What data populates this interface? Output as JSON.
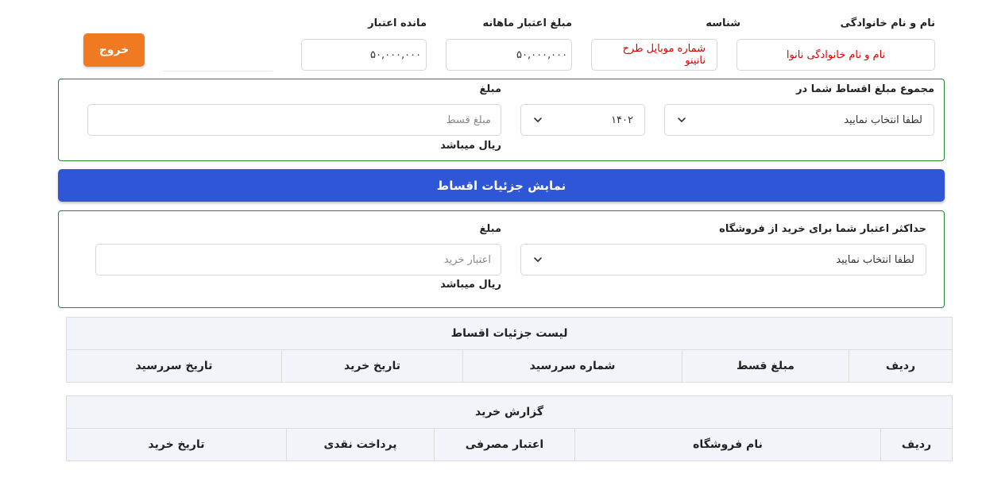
{
  "header": {
    "fields": [
      {
        "label": "نام و نام خانوادگی",
        "value": "نام و نام خانوادگی نانوا"
      },
      {
        "label": "شناسه",
        "value": "شماره موبایل طرح نانینو"
      },
      {
        "label": "مبلغ اعتبار ماهانه",
        "value": "۵۰,۰۰۰,۰۰۰"
      },
      {
        "label": "مانده اعتبار",
        "value": "۵۰,۰۰۰,۰۰۰"
      }
    ],
    "logout_label": "خروج"
  },
  "installments_panel": {
    "title": "مجموع مبلغ اقساط شما در",
    "month_select": "لطفا انتخاب نمایید",
    "year_select": "۱۴۰۲",
    "amount_label": "مبلغ",
    "amount_placeholder": "مبلغ قسط",
    "unit_text": "ریال میباشد"
  },
  "show_details_button": "نمایش جزئیات اقساط",
  "store_credit_panel": {
    "title": "حداکثر اعتبار شما برای خرید از فروشگاه",
    "store_select": "لطفا انتخاب نمایید",
    "amount_label": "مبلغ",
    "amount_placeholder": "اعتبار خرید",
    "unit_text": "ریال میباشد"
  },
  "installments_table": {
    "title": "لیست جزئیات اقساط",
    "columns": [
      "ردیف",
      "مبلغ قسط",
      "شماره سررسید",
      "تاریخ خرید",
      "تاریخ سررسید"
    ]
  },
  "purchase_table": {
    "title": "گزارش خرید",
    "columns": [
      "ردیف",
      "نام فروشگاه",
      "اعتبار مصرفی",
      "پرداخت نقدی",
      "تاریخ خرید"
    ]
  },
  "colors": {
    "accent_orange": "#f07a22",
    "primary_blue": "#2f56d6",
    "panel_green": "#1e8a2e",
    "value_red": "#d40000"
  }
}
